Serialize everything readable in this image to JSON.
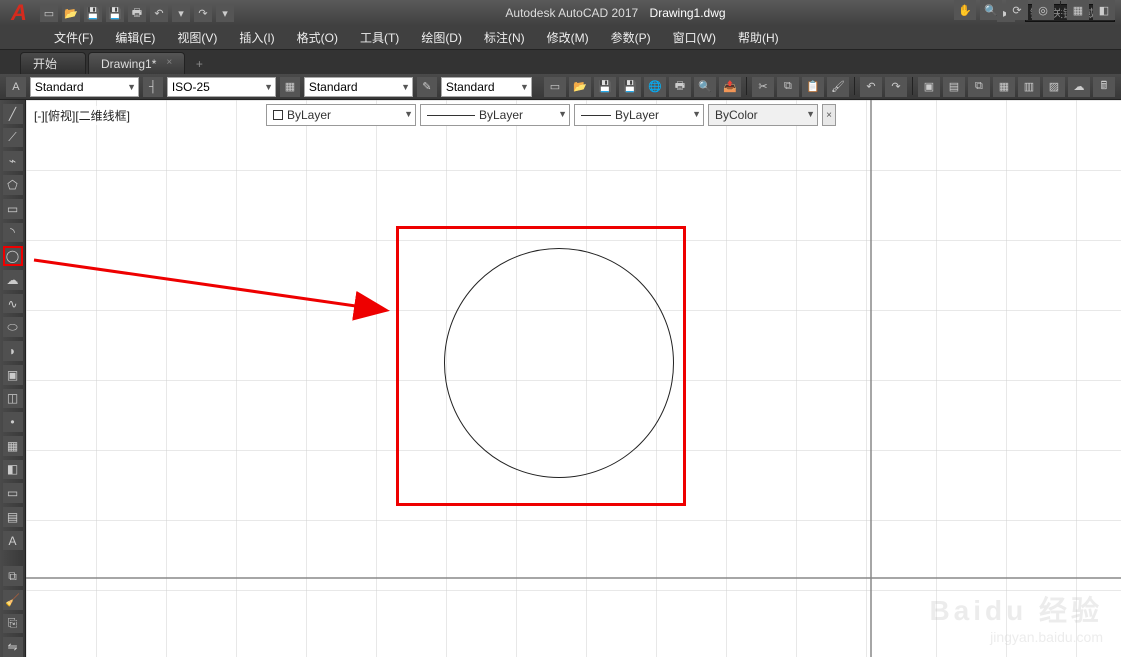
{
  "titlebar": {
    "app": "Autodesk AutoCAD 2017",
    "document": "Drawing1.dwg",
    "search_placeholder": "键入关键字或短"
  },
  "menubar": {
    "items": [
      "文件(F)",
      "编辑(E)",
      "视图(V)",
      "插入(I)",
      "格式(O)",
      "工具(T)",
      "绘图(D)",
      "标注(N)",
      "修改(M)",
      "参数(P)",
      "窗口(W)",
      "帮助(H)"
    ]
  },
  "tabs": {
    "start": "开始",
    "doc": "Drawing1*",
    "add": "+"
  },
  "ribbon": {
    "textstyle": "Standard",
    "dimstyle": "ISO-25",
    "tablestyle": "Standard",
    "mleaderstyle": "Standard"
  },
  "canvas": {
    "view_state": "[-][俯视][二维线框]",
    "prop": {
      "layer_color": "ByLayer",
      "linetype": "ByLayer",
      "lineweight": "ByLayer",
      "plotstyle": "ByColor"
    }
  },
  "watermark": {
    "line1": "Baidu 经验",
    "line2": "jingyan.baidu.com"
  }
}
